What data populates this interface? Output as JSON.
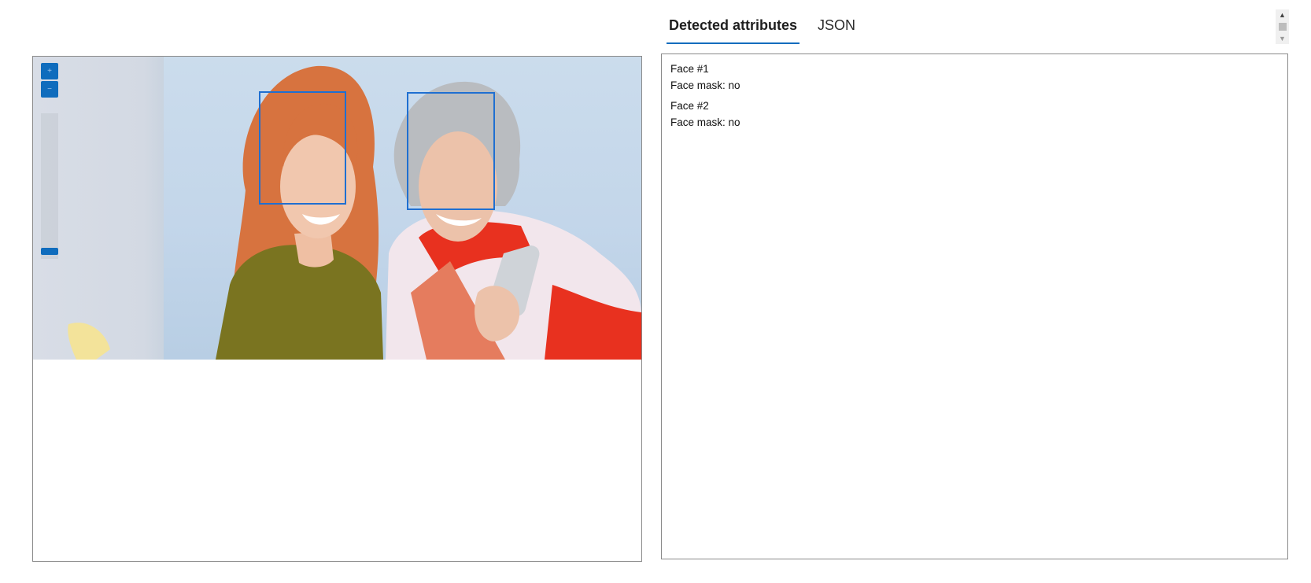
{
  "tabs": [
    {
      "label": "Detected attributes",
      "active": true
    },
    {
      "label": "JSON",
      "active": false
    }
  ],
  "results": [
    {
      "title": "Face #1",
      "attribute": "Face mask: no"
    },
    {
      "title": "Face #2",
      "attribute": "Face mask: no"
    }
  ],
  "viewer": {
    "zoom_in_icon": "plus-icon",
    "zoom_out_icon": "minus-icon",
    "zoom_level": 0.05
  },
  "colors": {
    "accent": "#0f6cbd",
    "face_box": "#1f6fd1",
    "border": "#8a8a8a"
  }
}
